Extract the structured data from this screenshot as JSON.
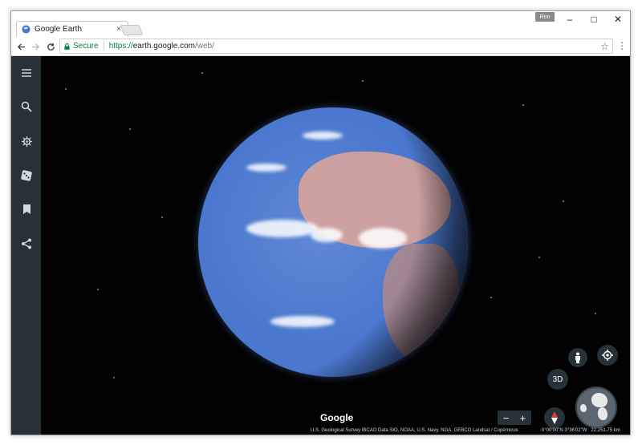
{
  "browser": {
    "tab_title": "Google Earth",
    "profile_name": "Ron",
    "security_label": "Secure",
    "url_scheme": "https://",
    "url_host": "earth.google.com",
    "url_path": "/web/",
    "icons": {
      "back": "arrow-left-icon",
      "forward": "arrow-right-icon",
      "reload": "reload-icon",
      "bookmark": "star-icon",
      "menu": "more-vert-icon",
      "lock": "lock-icon"
    },
    "window_controls": {
      "minimize": "–",
      "maximize": "□",
      "close": "✕"
    },
    "tab_close": "×"
  },
  "sidebar": {
    "items": [
      {
        "icon": "menu-icon",
        "name": "menu"
      },
      {
        "icon": "search-icon",
        "name": "search"
      },
      {
        "icon": "voyager-icon",
        "name": "voyager"
      },
      {
        "icon": "dice-icon",
        "name": "feeling-lucky"
      },
      {
        "icon": "bookmark-icon",
        "name": "my-places"
      },
      {
        "icon": "share-icon",
        "name": "share"
      }
    ]
  },
  "map": {
    "logo": "Google",
    "attribution": "U.S. Geological Survey  IBCAO  Data SIO, NOAA, U.S. Navy, NGA, GEBCO  Landsat / Copernicus",
    "coordinates": "0°00'00\"N 3°36'02\"W",
    "altitude": "22,251.75 km",
    "controls": {
      "three_d_label": "3D",
      "zoom_out": "−",
      "zoom_in": "+"
    }
  },
  "colors": {
    "sidebar_bg": "#263238",
    "secure_green": "#0b8043",
    "globe_ocean": "#4a78cf"
  }
}
